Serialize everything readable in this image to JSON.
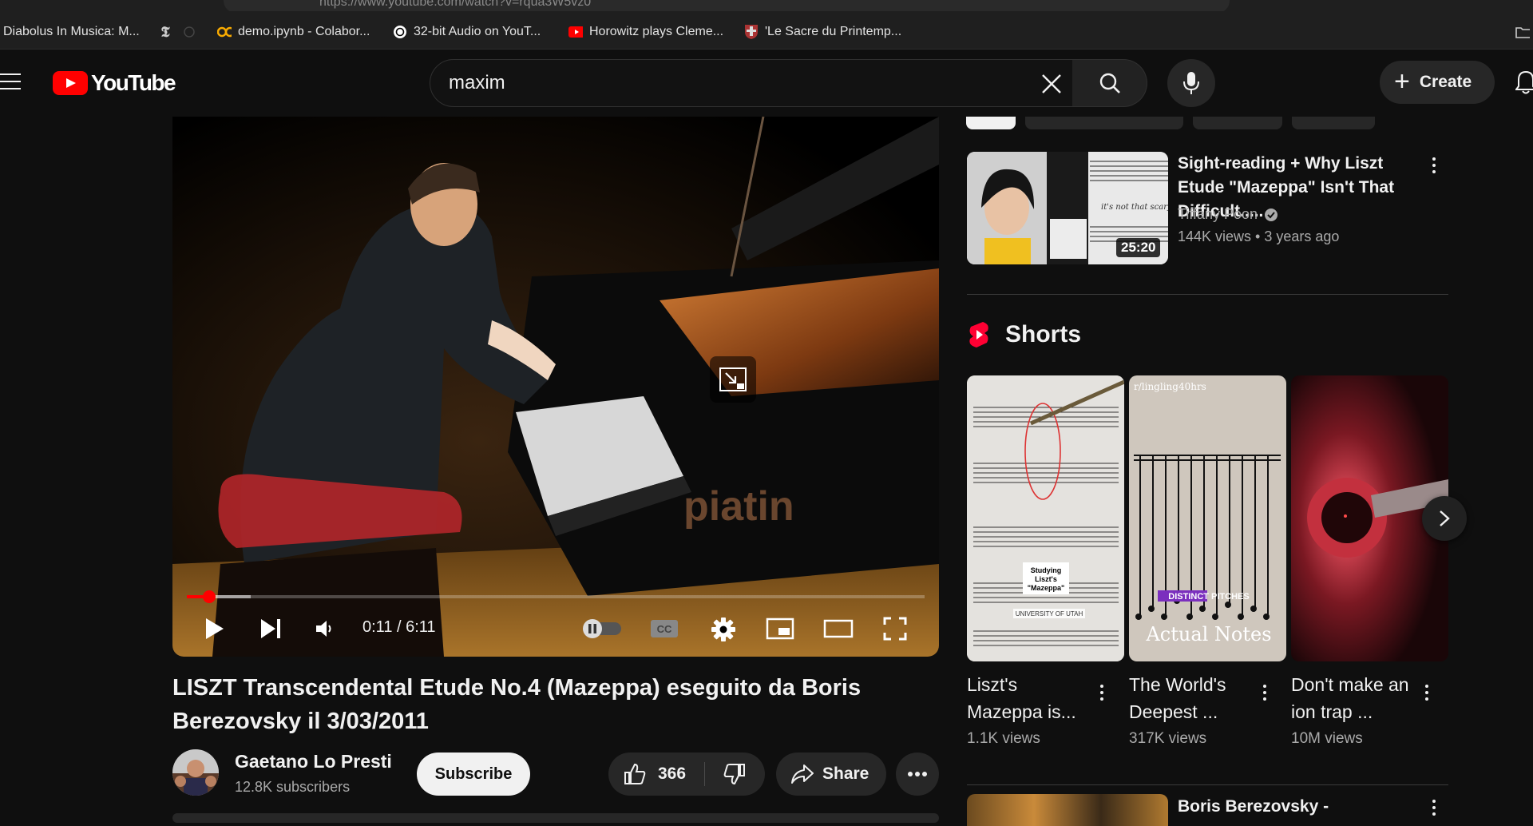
{
  "browser": {
    "url_visible": "https://www.youtube.com/watch?v=rqua3W5vz0",
    "bookmarks": [
      {
        "label": "Diabolus In Musica: M...",
        "icon": "none"
      },
      {
        "label": "",
        "icon": "nyt-icon"
      },
      {
        "label": "demo.ipynb - Colabor...",
        "icon": "colab-icon"
      },
      {
        "label": "32-bit Audio on YouT...",
        "icon": "openai-icon"
      },
      {
        "label": "Horowitz plays Cleme...",
        "icon": "youtube-icon"
      },
      {
        "label": "'Le Sacre du Printemp...",
        "icon": "crest-icon"
      }
    ]
  },
  "header": {
    "logo_text": "YouTube",
    "search_value": "maxim",
    "create_label": "Create"
  },
  "player": {
    "current_time": "0:11",
    "duration": "6:11",
    "time_display": "0:11 / 6:11",
    "progress": 0.03,
    "watermark": "piatin"
  },
  "video": {
    "title": "LISZT Transcendental Etude No.4 (Mazeppa) eseguito da Boris Berezovsky il 3/03/2011",
    "channel_name": "Gaetano Lo Presti",
    "subscribers": "12.8K subscribers",
    "subscribe_label": "Subscribe",
    "likes": "366",
    "share_label": "Share"
  },
  "recommendations": [
    {
      "title": "Sight-reading + Why Liszt Etude \"Mazeppa\" Isn't That Difficult.....",
      "channel": "Tiffany Poon",
      "meta": "144K views • 3 years ago",
      "duration": "25:20",
      "thumb_caption": "it's not that scary :)"
    },
    {
      "title": "Boris Berezovsky -"
    }
  ],
  "shorts": {
    "heading": "Shorts",
    "items": [
      {
        "title": "Liszt's Mazeppa is...",
        "views": "1.1K views",
        "overlay": "Studying Liszt's \"Mazeppa\"",
        "overlay2": "UNIVERSITY OF UTAH"
      },
      {
        "title": "The World's Deepest ...",
        "views": "317K views",
        "overlay": "DISTINCT PITCHES",
        "overlay2": "Actual Notes",
        "overlay3": "r/lingling40hrs"
      },
      {
        "title": "Don't make an ion trap ...",
        "views": "10M views"
      }
    ]
  },
  "colors": {
    "brand_red": "#ff0000",
    "background": "#0f0f0f",
    "surface": "#272727",
    "secondary_text": "#aaaaaa"
  }
}
